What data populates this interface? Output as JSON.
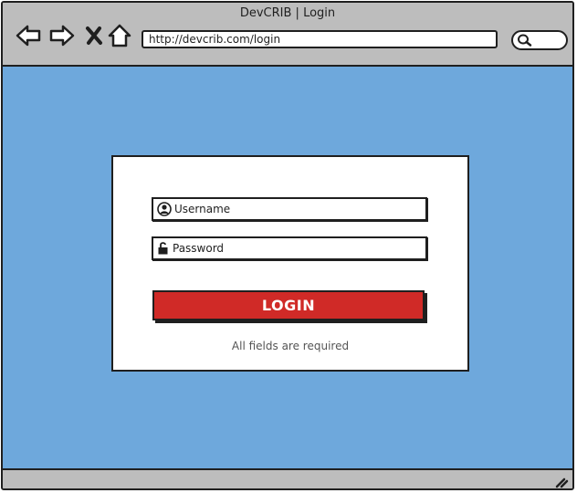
{
  "window": {
    "title": "DevCRIB | Login"
  },
  "toolbar": {
    "back_icon": "back-arrow-icon",
    "forward_icon": "forward-arrow-icon",
    "close_icon": "close-x-icon",
    "home_icon": "home-icon",
    "url": "http://devcrib.com/login",
    "search_icon": "search-icon"
  },
  "login": {
    "username_placeholder": "Username",
    "username_icon": "user-icon",
    "password_placeholder": "Password",
    "password_icon": "unlock-icon",
    "button_label": "LOGIN",
    "helper_text": "All fields are required"
  },
  "colors": {
    "chrome": "#bdbdbd",
    "background": "#6ea8dc",
    "card": "#ffffff",
    "button": "#d02a27",
    "outline": "#1f1f1f"
  }
}
